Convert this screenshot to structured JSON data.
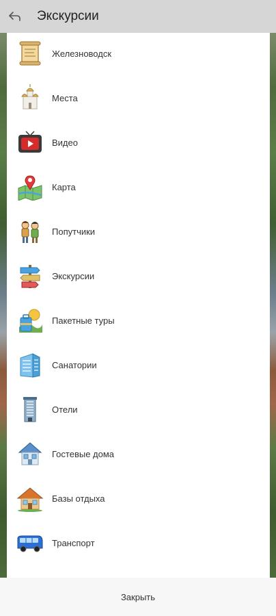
{
  "header": {
    "title": "Экскурсии",
    "back_icon": "back-arrow-icon"
  },
  "menu": {
    "items": [
      {
        "label": "Железноводск",
        "icon": "scroll-map-icon"
      },
      {
        "label": "Места",
        "icon": "church-icon"
      },
      {
        "label": "Видео",
        "icon": "tv-play-icon"
      },
      {
        "label": "Карта",
        "icon": "map-pin-icon"
      },
      {
        "label": "Попутчики",
        "icon": "travelers-icon"
      },
      {
        "label": "Экскурсии",
        "icon": "signpost-icon"
      },
      {
        "label": "Пакетные туры",
        "icon": "travel-package-icon"
      },
      {
        "label": "Санатории",
        "icon": "sanatorium-building-icon"
      },
      {
        "label": "Отели",
        "icon": "hotel-tower-icon"
      },
      {
        "label": "Гостевые дома",
        "icon": "guest-house-icon"
      },
      {
        "label": "Базы отдыха",
        "icon": "cottage-icon"
      },
      {
        "label": "Транспорт",
        "icon": "bus-icon"
      }
    ]
  },
  "footer": {
    "close_label": "Закрыть"
  },
  "colors": {
    "topbar": "#d6d6d6",
    "panel": "#ffffff",
    "text": "#333333"
  }
}
